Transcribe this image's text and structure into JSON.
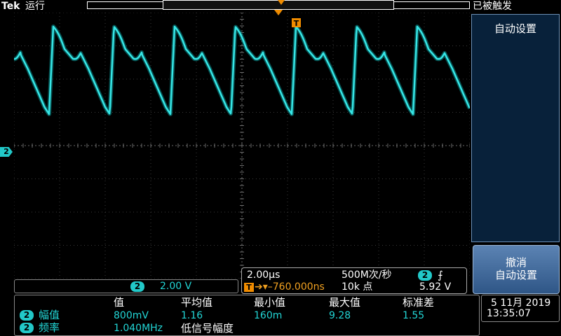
{
  "header": {
    "brand": "Tek",
    "run_state": "运行",
    "trigger_state": "已被触发"
  },
  "side_panel": {
    "title": "自动设置",
    "undo_line1": "撤消",
    "undo_line2": "自动设置"
  },
  "channel": {
    "id": "2",
    "scale": "2.00 V",
    "color": "#22c8c8"
  },
  "horizontal": {
    "time_per_div": "2.00µs",
    "sample_rate": "500M次/秒",
    "trigger_channel": "2",
    "trigger_delay": "➔▾–760.000ns",
    "record_length": "10k 点",
    "trigger_level": "5.92 V"
  },
  "measurements": {
    "headers": [
      "值",
      "平均值",
      "最小值",
      "最大值",
      "标准差"
    ],
    "rows": [
      {
        "channel": "2",
        "name": "幅值",
        "values": [
          "800mV",
          "1.16",
          "160m",
          "9.28",
          "1.55"
        ]
      },
      {
        "channel": "2",
        "name": "频率",
        "values": [
          "1.040MHz",
          "低信号幅度",
          "",
          "",
          ""
        ]
      }
    ]
  },
  "clock": {
    "date": "5 11月 2019",
    "time": "13:35:07"
  },
  "markers": {
    "trigger_label": "T",
    "timeline_label": "T"
  }
}
